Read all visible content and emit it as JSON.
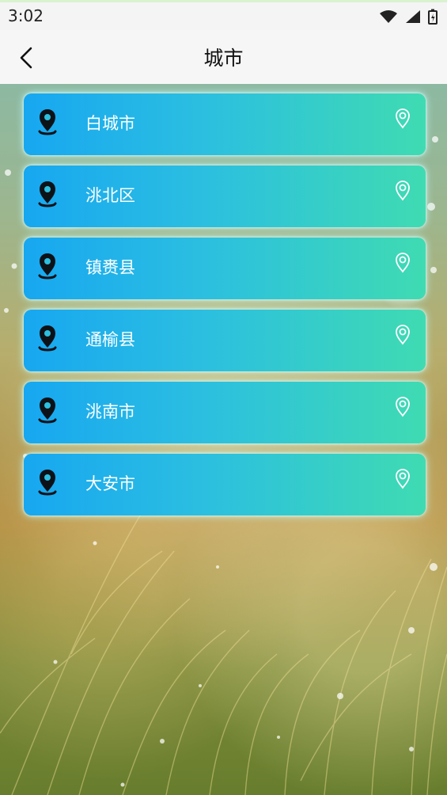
{
  "status_bar": {
    "time": "3:02",
    "icons": [
      "wifi-icon",
      "signal-icon",
      "battery-icon"
    ]
  },
  "header": {
    "title": "城市",
    "back_icon": "chevron-left-icon"
  },
  "colors": {
    "card_gradient_start": "#17a7f1",
    "card_gradient_end": "#3fdbb2",
    "card_text": "#ffffff",
    "card_icon": "#0b1218"
  },
  "cities": [
    {
      "name": "白城市"
    },
    {
      "name": "洮北区"
    },
    {
      "name": "镇赉县"
    },
    {
      "name": "通榆县"
    },
    {
      "name": "洮南市"
    },
    {
      "name": "大安市"
    }
  ]
}
